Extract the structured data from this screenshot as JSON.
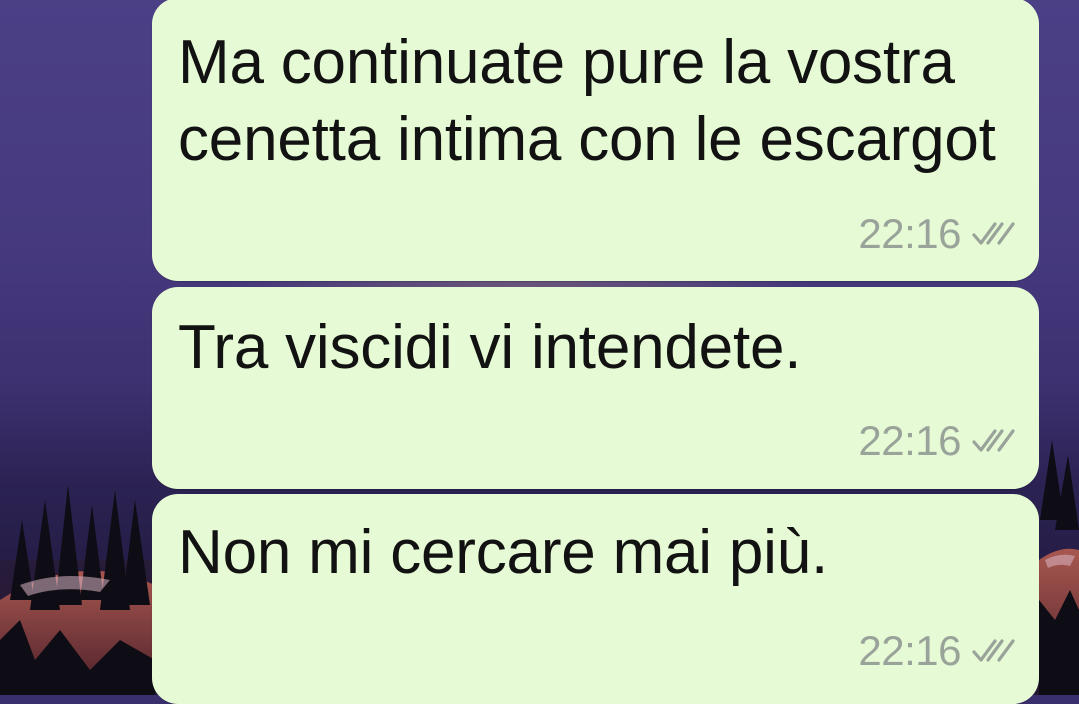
{
  "messages": [
    {
      "text": "Ma continuate pure la vostra cenetta intima con le escargot",
      "time": "22:16",
      "status_icon": "double-check-icon"
    },
    {
      "text": "Tra viscidi vi intendete.",
      "time": "22:16",
      "status_icon": "double-check-icon"
    },
    {
      "text": "Non mi cercare mai più.",
      "time": "22:16",
      "status_icon": "double-check-icon"
    }
  ],
  "colors": {
    "bubble": "#e6fbd5",
    "text": "#121212",
    "time": "#9aa39a",
    "ticks": "#9aa39a",
    "wallpaper_sky": "#46397e"
  }
}
